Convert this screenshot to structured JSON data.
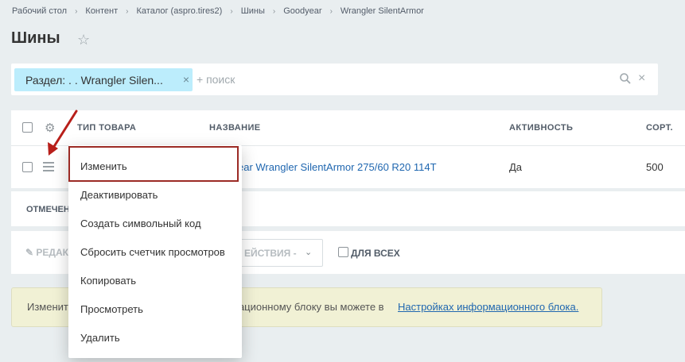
{
  "breadcrumbs": [
    "Рабочий стол",
    "Контент",
    "Каталог (aspro.tires2)",
    "Шины",
    "Goodyear",
    "Wrangler SilentArmor"
  ],
  "page": {
    "title": "Шины",
    "favorite_icon": "star-icon"
  },
  "filter": {
    "chip_label": "Раздел: . . Wrangler Silen...",
    "chip_remove": "×",
    "search_placeholder": "+ поиск",
    "clear": "×"
  },
  "table": {
    "headers": {
      "type": "ТИП ТОВАРА",
      "name": "НАЗВАНИЕ",
      "active": "АКТИВНОСТЬ",
      "sort": "СОРТ."
    },
    "rows": [
      {
        "name": "ear Wrangler SilentArmor 275/60 R20 114T",
        "active": "Да",
        "sort": "500"
      }
    ]
  },
  "selected": {
    "label": "ОТМЕЧЕН"
  },
  "action_bar": {
    "edit_label": "✎ РЕДАК",
    "actions_select": "ЕЙСТВИЯ -",
    "for_all": "ДЛЯ ВСЕХ"
  },
  "notice": {
    "pre": "Изменить",
    "mid": "мационному блоку вы можете в",
    "link": "Настройках информационного блока."
  },
  "context_menu": {
    "items": [
      "Изменить",
      "Деактивировать",
      "Создать символьный код",
      "Сбросить счетчик просмотров",
      "Копировать",
      "Просмотреть",
      "Удалить"
    ]
  },
  "colors": {
    "accent": "#2067b0",
    "highlight_border": "#9c2b25",
    "arrow": "#b81f1a",
    "chip_bg": "#bcedfc"
  }
}
